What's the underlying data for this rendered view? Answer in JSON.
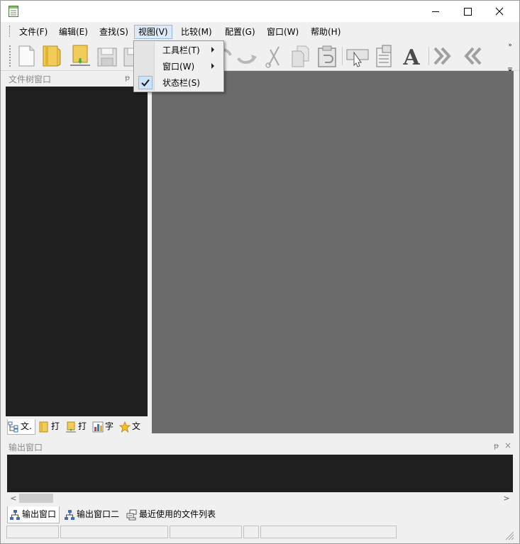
{
  "menubar": {
    "items": [
      {
        "label": "文件(F)"
      },
      {
        "label": "编辑(E)"
      },
      {
        "label": "查找(S)"
      },
      {
        "label": "视图(V)"
      },
      {
        "label": "比较(M)"
      },
      {
        "label": "配置(G)"
      },
      {
        "label": "窗口(W)"
      },
      {
        "label": "帮助(H)"
      }
    ]
  },
  "view_menu": {
    "items": [
      {
        "label": "工具栏(T)",
        "has_submenu": true
      },
      {
        "label": "窗口(W)",
        "has_submenu": true
      },
      {
        "label": "状态栏(S)",
        "checked": true
      }
    ]
  },
  "toolbar": {
    "icons": [
      "new-file-icon",
      "open-file-icon",
      "open-folder-icon",
      "save-icon",
      "save-all-icon",
      "undo-icon",
      "redo-icon",
      "cut-icon",
      "copy-icon",
      "paste-icon",
      "select-icon",
      "compare-icon",
      "font-icon",
      "next-diff-icon",
      "prev-diff-icon"
    ],
    "overflow_glyph": "»",
    "font_glyph": "A"
  },
  "tree_panel": {
    "title": "文件树窗口",
    "pin_glyph": "ᵽ",
    "tabs": [
      {
        "label": "文."
      },
      {
        "label": "打"
      },
      {
        "label": "打"
      },
      {
        "label": "字"
      },
      {
        "label": "文"
      }
    ]
  },
  "output_panel": {
    "title": "输出窗口",
    "pin_glyph": "ᵽ",
    "close_glyph": "×",
    "scroll_left": "<",
    "scroll_right": ">",
    "tabs": [
      {
        "label": "输出窗口"
      },
      {
        "label": "输出窗口二"
      },
      {
        "label": "最近使用的文件列表"
      }
    ]
  },
  "colors": {
    "panel_dark": "#1f1f1f",
    "editor_area": "#6b6b6b",
    "chrome": "#f0f0f0",
    "menu_highlight": "#dfe9f5"
  }
}
